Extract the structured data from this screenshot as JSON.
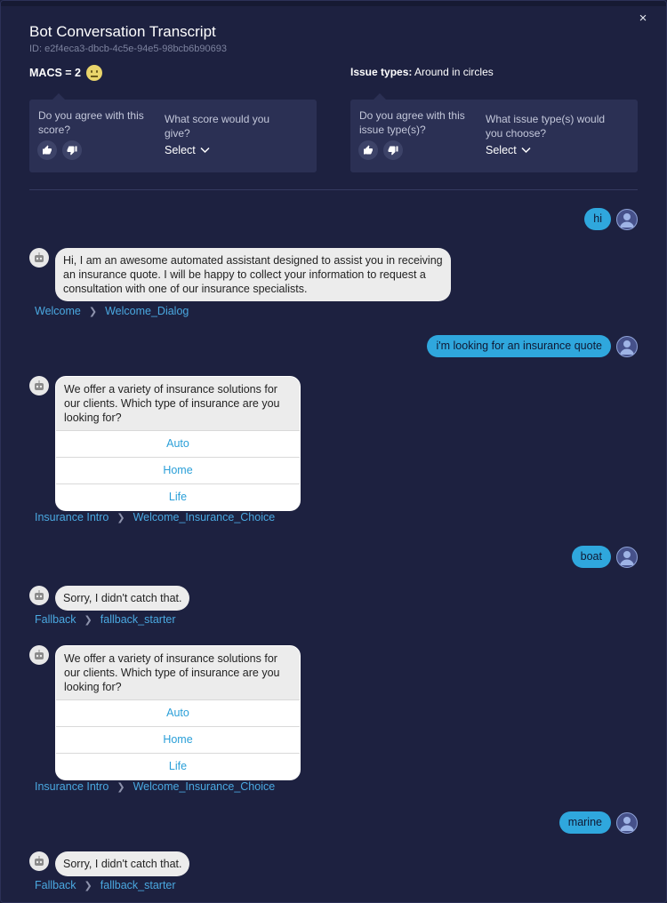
{
  "header": {
    "title": "Bot Conversation Transcript",
    "id_text": "ID: e2f4eca3-dbcb-4c5e-94e5-98bcb6b90693",
    "close_icon": "×"
  },
  "macs": {
    "label": "MACS = 2",
    "emoji": "neutral-face"
  },
  "issue": {
    "label": "Issue types:",
    "value": "Around in circles"
  },
  "score_card": {
    "agree_question": "Do you agree with this score?",
    "choose_question": "What score would you give?",
    "select_label": "Select"
  },
  "issue_card": {
    "agree_question": "Do you agree with this issue type(s)?",
    "choose_question": "What issue type(s) would you choose?",
    "select_label": "Select"
  },
  "messages": {
    "user_1": "hi",
    "bot_1": "Hi, I am an awesome automated assistant designed to assist you in receiving an insurance quote. I will be happy to collect your information to request a consultation with one of our insurance specialists.",
    "crumb_1": [
      "Welcome",
      "Welcome_Dialog"
    ],
    "user_2": "i'm looking for an insurance quote",
    "bot_2": "We offer a variety of insurance solutions for our clients. Which type of insurance are you looking for?",
    "bot_2_choices": [
      "Auto",
      "Home",
      "Life"
    ],
    "crumb_2": [
      "Insurance Intro",
      "Welcome_Insurance_Choice"
    ],
    "user_3": "boat",
    "bot_3": "Sorry, I didn't catch that.",
    "crumb_3": [
      "Fallback",
      "fallback_starter"
    ],
    "bot_4": "We offer a variety of insurance solutions for our clients. Which type of insurance are you looking for?",
    "bot_4_choices": [
      "Auto",
      "Home",
      "Life"
    ],
    "crumb_4": [
      "Insurance Intro",
      "Welcome_Insurance_Choice"
    ],
    "user_4": "marine",
    "bot_5": "Sorry, I didn't catch that.",
    "crumb_5": [
      "Fallback",
      "fallback_starter"
    ]
  },
  "colors": {
    "background": "#1d2140",
    "card": "#2b3054",
    "user_bubble": "#2fa7dd",
    "link": "#4aa8e0",
    "bot_bubble": "#ececec"
  }
}
